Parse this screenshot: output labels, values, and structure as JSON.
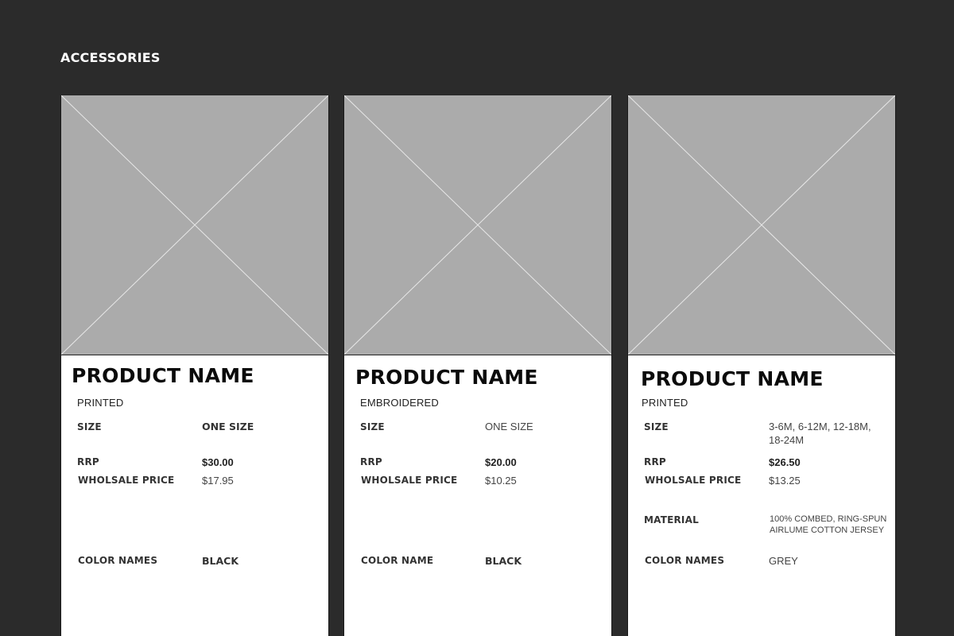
{
  "section_title": "ACCESSORIES",
  "cards": [
    {
      "name": "PRODUCT NAME",
      "type": "PRINTED",
      "size_label": "SIZE",
      "size_value": "ONE SIZE",
      "rrp_label": "RRP",
      "rrp_value": "$30.00",
      "wholesale_label": "WHOLSALE PRICE",
      "wholesale_value": "$17.95",
      "color_label": "COLOR NAMES",
      "color_value": "BLACK"
    },
    {
      "name": "PRODUCT NAME",
      "type": "EMBROIDERED",
      "size_label": "SIZE",
      "size_value": "ONE SIZE",
      "rrp_label": "RRP",
      "rrp_value": "$20.00",
      "wholesale_label": "WHOLSALE PRICE",
      "wholesale_value": "$10.25",
      "color_label": "COLOR NAME",
      "color_value": "BLACK"
    },
    {
      "name": "PRODUCT NAME",
      "type": "PRINTED",
      "size_label": "SIZE",
      "size_value": "3-6M, 6-12M, 12-18M, 18-24M",
      "rrp_label": "RRP",
      "rrp_value": "$26.50",
      "wholesale_label": "WHOLSALE PRICE",
      "wholesale_value": "$13.25",
      "material_label": "MATERIAL",
      "material_value": "100% COMBED, RING-SPUN AIRLUME COTTON JERSEY",
      "color_label": "COLOR NAMES",
      "color_value": "GREY"
    }
  ],
  "colors": {
    "background": "#2b2b2b",
    "card": "#ffffff",
    "placeholder": "#ababab"
  }
}
